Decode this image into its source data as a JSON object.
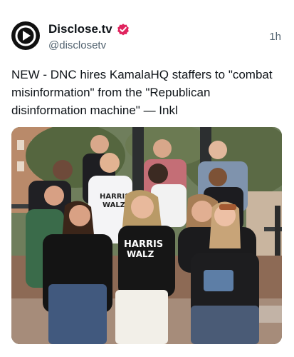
{
  "post": {
    "display_name": "Disclose.tv",
    "handle": "@disclosetv",
    "timestamp": "1h",
    "text": "NEW - DNC hires KamalaHQ staffers to \"combat misinformation\" from the \"Republican disinformation machine\" — Inkl"
  },
  "icons": {
    "avatar": "play-logo-icon",
    "verified": "verified-badge-icon"
  },
  "photo": {
    "shirt_lines": [
      "HARRIS",
      "WALZ"
    ]
  },
  "colors": {
    "verified_badge": "#e0245e",
    "secondary_text": "#536471",
    "primary_text": "#0f1419"
  }
}
